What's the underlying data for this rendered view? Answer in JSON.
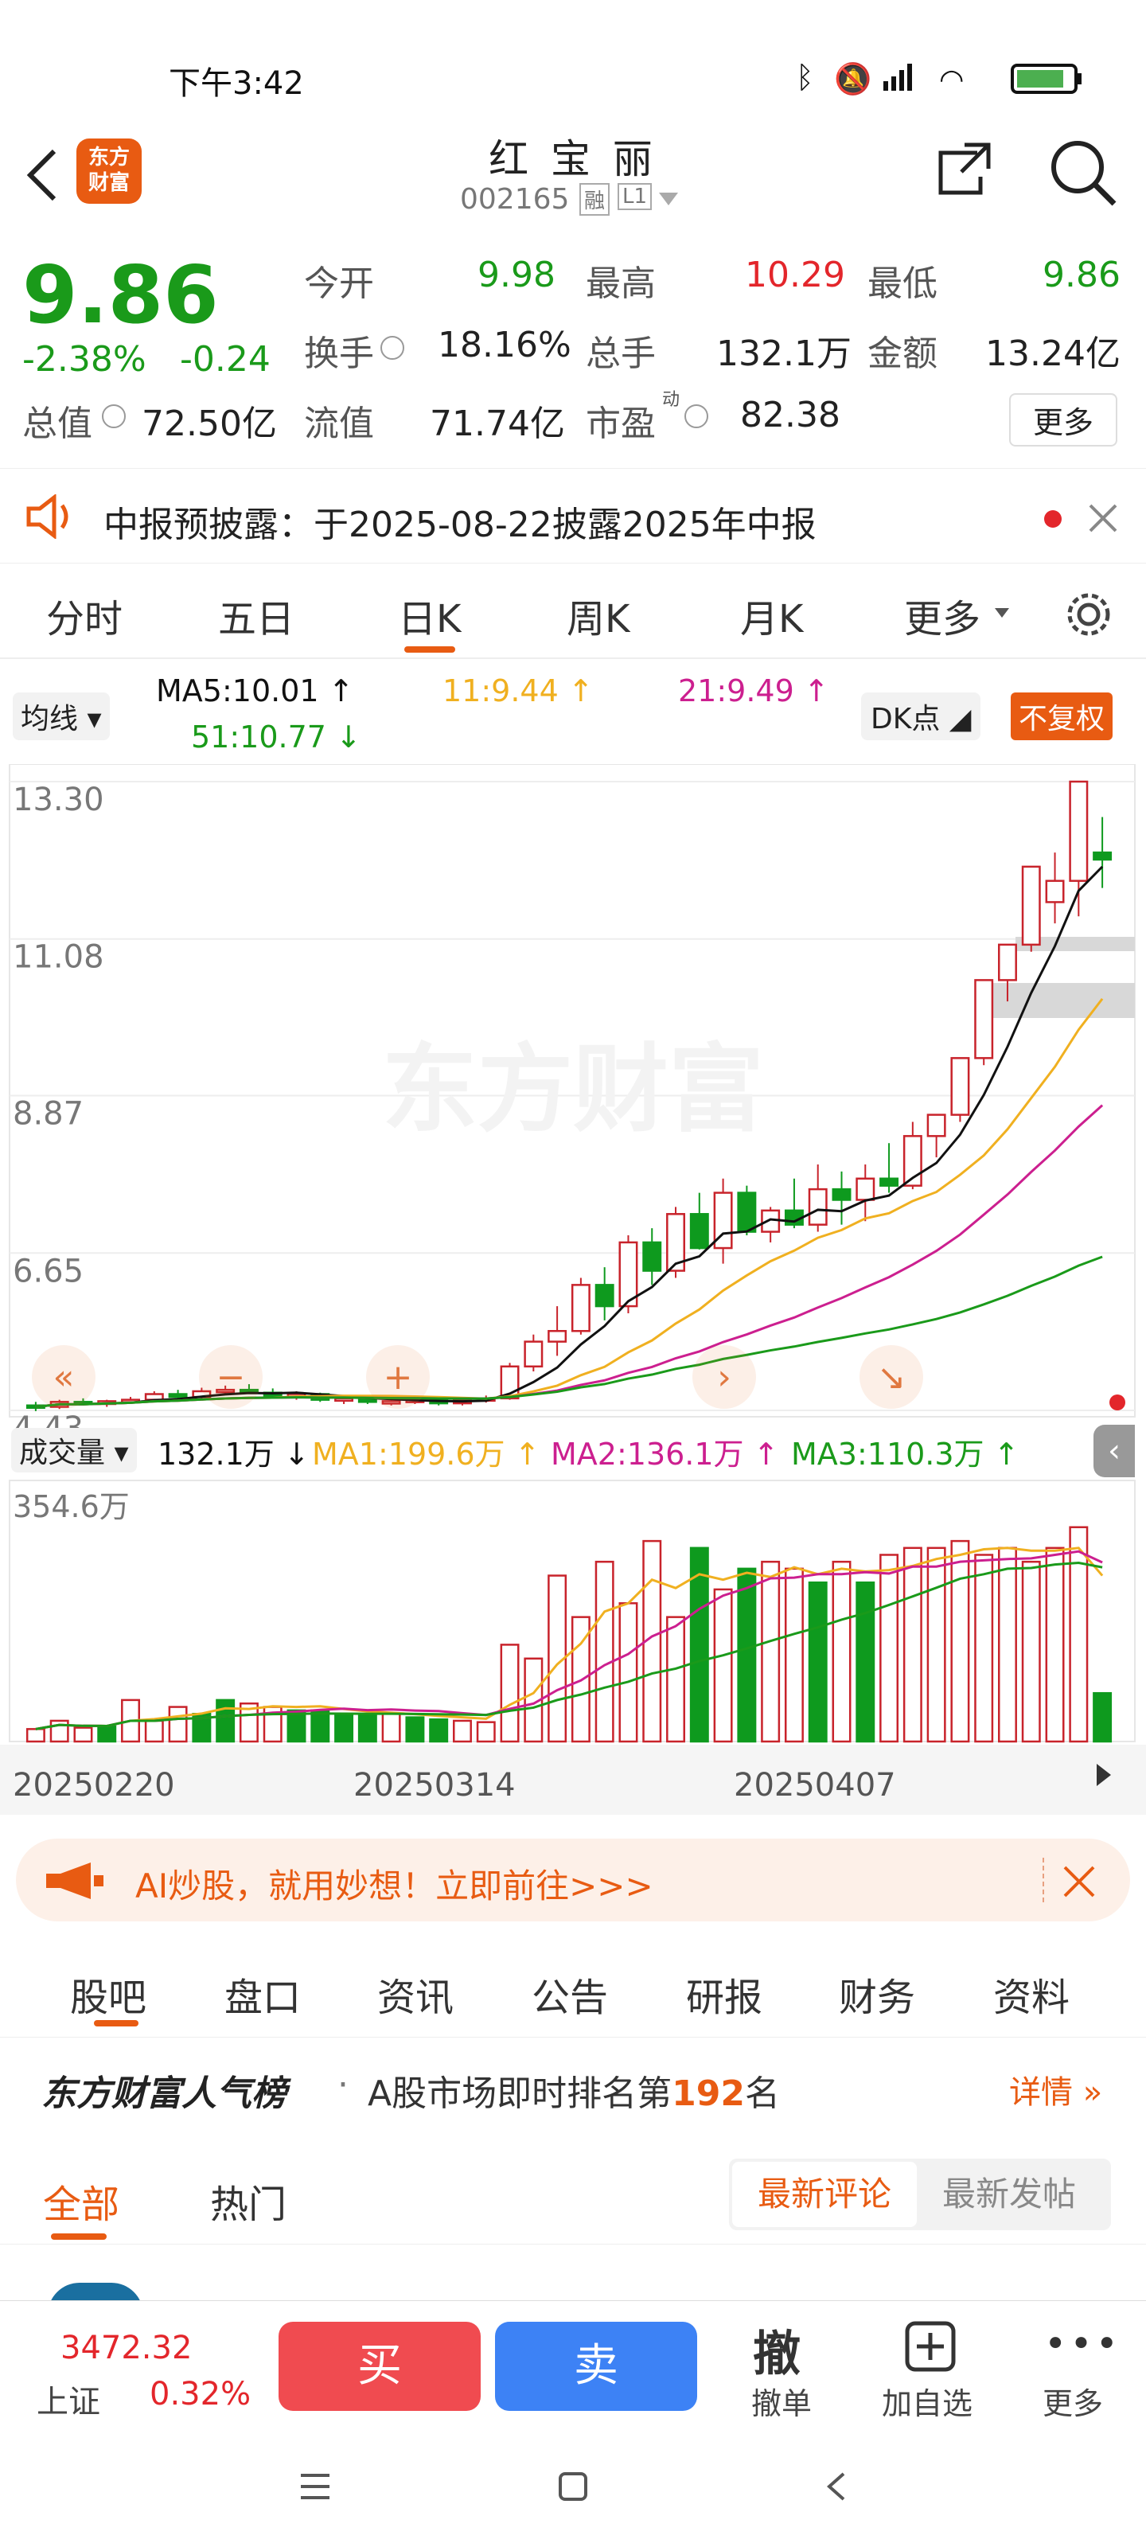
{
  "status_bar": {
    "time": "下午3:42"
  },
  "header": {
    "stock_name": "红 宝 丽",
    "stock_code": "002165",
    "badge_rong": "融",
    "badge_l1": "L1"
  },
  "quote": {
    "price": "9.86",
    "change_pct": "-2.38%",
    "change_amt": "-0.24",
    "open_label": "今开",
    "open": "9.98",
    "high_label": "最高",
    "high": "10.29",
    "low_label": "最低",
    "low": "9.86",
    "turnover_label": "换手",
    "turnover": "18.16%",
    "volume_label": "总手",
    "volume": "132.1万",
    "amount_label": "金额",
    "amount": "13.24亿",
    "mcap_label": "总值",
    "mcap": "72.50亿",
    "float_label": "流值",
    "float": "71.74亿",
    "pe_label": "市盈",
    "pe_sup": "动",
    "pe": "82.38",
    "more": "更多"
  },
  "notice": {
    "text": "中报预披露：于2025-08-22披露2025年中报"
  },
  "tabs": [
    "分时",
    "五日",
    "日K",
    "周K",
    "月K",
    "更多"
  ],
  "active_tab": "日K",
  "ma": {
    "selector": "均线",
    "ma5": "MA5:10.01",
    "ma11": "11:9.44",
    "ma21": "21:9.49",
    "ma51": "51:10.77",
    "dk": "DK点",
    "fuquan": "不复权"
  },
  "chart_data": {
    "type": "candlestick",
    "price_ticks": [
      "13.30",
      "11.08",
      "8.87",
      "6.65",
      "4.43"
    ],
    "volume_ticks": [
      "354.6万"
    ],
    "x_labels": [
      "20250220",
      "20250314",
      "20250407"
    ],
    "volume_header": {
      "selector": "成交量",
      "vol": "132.1万",
      "ma1": "MA1:199.6万",
      "ma2": "MA2:136.1万",
      "ma3": "MA3:110.3万"
    },
    "candles": [
      [
        4.5,
        4.55,
        4.42,
        4.48
      ],
      [
        4.48,
        4.58,
        4.45,
        4.55
      ],
      [
        4.55,
        4.6,
        4.5,
        4.52
      ],
      [
        4.52,
        4.58,
        4.48,
        4.56
      ],
      [
        4.56,
        4.62,
        4.52,
        4.58
      ],
      [
        4.58,
        4.7,
        4.55,
        4.66
      ],
      [
        4.66,
        4.72,
        4.6,
        4.62
      ],
      [
        4.62,
        4.75,
        4.6,
        4.7
      ],
      [
        4.7,
        4.78,
        4.65,
        4.72
      ],
      [
        4.72,
        4.8,
        4.68,
        4.68
      ],
      [
        4.68,
        4.74,
        4.62,
        4.64
      ],
      [
        4.64,
        4.7,
        4.58,
        4.66
      ],
      [
        4.66,
        4.68,
        4.55,
        4.58
      ],
      [
        4.58,
        4.64,
        4.52,
        4.6
      ],
      [
        4.6,
        4.62,
        4.52,
        4.55
      ],
      [
        4.55,
        4.6,
        4.5,
        4.56
      ],
      [
        4.56,
        4.62,
        4.52,
        4.58
      ],
      [
        4.58,
        4.62,
        4.5,
        4.53
      ],
      [
        4.53,
        4.6,
        4.5,
        4.57
      ],
      [
        4.57,
        4.64,
        4.54,
        4.6
      ],
      [
        4.6,
        5.1,
        4.58,
        5.05
      ],
      [
        5.05,
        5.5,
        4.98,
        5.4
      ],
      [
        5.4,
        5.9,
        5.2,
        5.55
      ],
      [
        5.55,
        6.3,
        5.5,
        6.2
      ],
      [
        6.2,
        6.45,
        5.7,
        5.9
      ],
      [
        5.9,
        6.9,
        5.8,
        6.8
      ],
      [
        6.8,
        7.0,
        6.2,
        6.4
      ],
      [
        6.4,
        7.3,
        6.3,
        7.2
      ],
      [
        7.2,
        7.5,
        6.7,
        6.72
      ],
      [
        6.72,
        7.7,
        6.5,
        7.5
      ],
      [
        7.5,
        7.6,
        6.9,
        6.95
      ],
      [
        6.95,
        7.3,
        6.8,
        7.25
      ],
      [
        7.25,
        7.7,
        7.0,
        7.05
      ],
      [
        7.05,
        7.9,
        6.95,
        7.55
      ],
      [
        7.55,
        7.8,
        7.05,
        7.4
      ],
      [
        7.4,
        7.9,
        7.1,
        7.7
      ],
      [
        7.7,
        8.2,
        7.5,
        7.6
      ],
      [
        7.6,
        8.5,
        7.55,
        8.3
      ],
      [
        8.3,
        8.6,
        8.0,
        8.6
      ],
      [
        8.6,
        9.4,
        8.5,
        9.4
      ],
      [
        9.4,
        10.5,
        9.3,
        10.5
      ],
      [
        10.5,
        11.0,
        10.2,
        11.0
      ],
      [
        11.0,
        12.1,
        10.9,
        12.1
      ],
      [
        11.6,
        12.3,
        11.3,
        11.9
      ],
      [
        11.9,
        13.3,
        11.4,
        13.3
      ],
      [
        12.3,
        12.8,
        11.8,
        12.2
      ]
    ],
    "volumes": [
      18,
      30,
      20,
      22,
      60,
      30,
      50,
      40,
      60,
      55,
      50,
      45,
      45,
      40,
      38,
      40,
      35,
      32,
      30,
      28,
      140,
      120,
      240,
      180,
      260,
      200,
      290,
      180,
      280,
      220,
      250,
      260,
      250,
      230,
      260,
      230,
      270,
      280,
      280,
      290,
      270,
      280,
      260,
      280,
      310,
      70
    ],
    "volume_down": [
      false,
      false,
      false,
      true,
      false,
      false,
      false,
      true,
      true,
      false,
      false,
      true,
      true,
      true,
      true,
      false,
      true,
      true,
      false,
      false,
      false,
      false,
      false,
      false,
      false,
      false,
      false,
      false,
      true,
      false,
      true,
      false,
      false,
      true,
      false,
      true,
      false,
      false,
      false,
      false,
      false,
      false,
      false,
      false,
      false,
      true
    ]
  },
  "banner": {
    "text": "AI炒股，就用妙想！立即前往>>>"
  },
  "subtabs": [
    "股吧",
    "盘口",
    "资讯",
    "公告",
    "研报",
    "财务",
    "资料"
  ],
  "rank": {
    "brand": "东方财富人气榜",
    "text_a": "A股市场即时排名第",
    "rank": "192",
    "text_b": "名",
    "detail": "详情"
  },
  "filter": {
    "all": "全部",
    "hot": "热门",
    "latest_comment": "最新评论",
    "latest_post": "最新发帖"
  },
  "bottom": {
    "index_value": "3472.32",
    "index_name": "上证",
    "index_pct": "0.32%",
    "buy": "买",
    "sell": "卖",
    "cancel_glyph": "撤",
    "cancel": "撤单",
    "add_fav": "加自选",
    "more": "更多"
  },
  "watermark": "东方财富",
  "logo_text": "东方财富"
}
